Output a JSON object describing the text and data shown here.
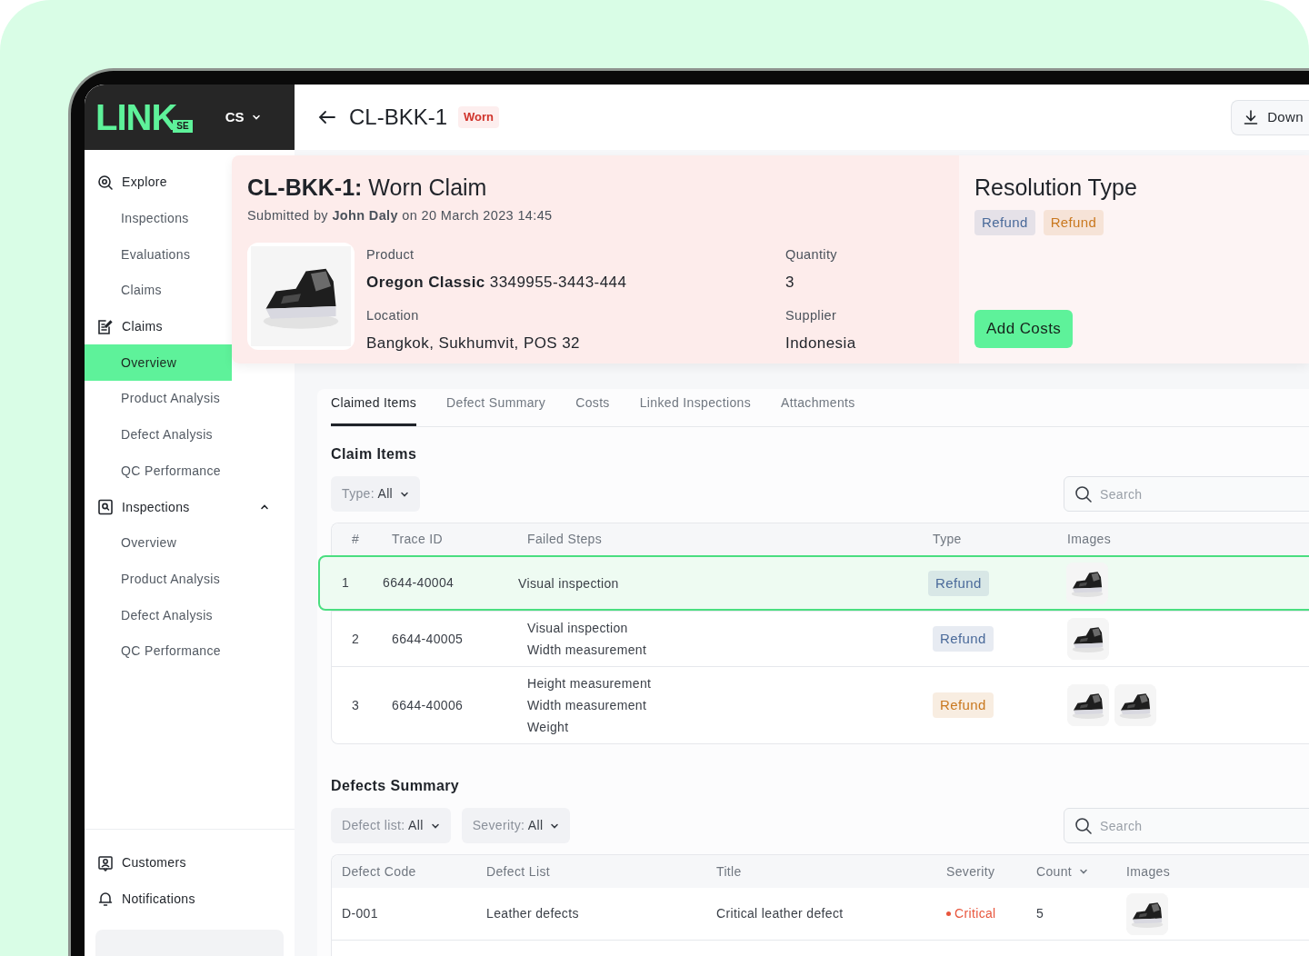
{
  "logo": {
    "text": "LINK",
    "badge": "SE"
  },
  "org_switcher": {
    "label": "CS"
  },
  "sidebar": {
    "sections": [
      {
        "label": "Explore",
        "children": [
          {
            "label": "Inspections",
            "selected": false
          },
          {
            "label": "Evaluations",
            "selected": false
          },
          {
            "label": "Claims",
            "selected": false
          }
        ]
      },
      {
        "label": "Claims",
        "children": [
          {
            "label": "Overview",
            "selected": true
          },
          {
            "label": "Product Analysis",
            "selected": false
          },
          {
            "label": "Defect Analysis",
            "selected": false
          },
          {
            "label": "QC Performance",
            "selected": false
          }
        ]
      },
      {
        "label": "Inspections",
        "expanded": true,
        "children": [
          {
            "label": "Overview",
            "selected": false
          },
          {
            "label": "Product Analysis",
            "selected": false
          },
          {
            "label": "Defect Analysis",
            "selected": false
          },
          {
            "label": "QC Performance",
            "selected": false
          }
        ]
      }
    ],
    "footer": [
      {
        "label": "Customers"
      },
      {
        "label": "Notifications"
      }
    ]
  },
  "header": {
    "title": "CL-BKK-1",
    "badge": "Worn",
    "download_button": "Down"
  },
  "summary": {
    "code": "CL-BKK-1:",
    "title": "Worn Claim",
    "submitted": "Submitted by **John Daly** on 20 March 2023 14:45",
    "fields": [
      {
        "label": "Product",
        "value": "**Oregon Classic** 3349955-3443-444"
      },
      {
        "label": "Quantity",
        "value": "3"
      },
      {
        "label": "Location",
        "value": "Bangkok, Sukhumvit, POS 32"
      },
      {
        "label": "Supplier",
        "value": "Indonesia"
      }
    ]
  },
  "resolution": {
    "title": "Resolution Type",
    "tags": [
      {
        "label": "Refund",
        "color": "#4a6a9a"
      },
      {
        "label": "Refund",
        "color": "#c9781f"
      }
    ],
    "button": "Add Costs"
  },
  "tabs": [
    {
      "label": "Claimed Items",
      "selected": true
    },
    {
      "label": "Defect Summary",
      "selected": false
    },
    {
      "label": "Costs",
      "selected": false
    },
    {
      "label": "Linked Inspections",
      "selected": false
    },
    {
      "label": "Attachments",
      "selected": false
    }
  ],
  "claim_items": {
    "title": "Claim Items",
    "filter": {
      "label": "Type:",
      "value": "All"
    },
    "search": {
      "placeholder": "Search"
    },
    "columns": [
      "#",
      "Trace ID",
      "Failed Steps",
      "Type",
      "Images"
    ],
    "rows": [
      {
        "number": "1",
        "trace_id": "6644-40004",
        "failed_steps": [
          "Visual inspection"
        ],
        "type": {
          "label": "Refund",
          "color": "#4a6a9a"
        },
        "images": [
          {
            "kind": "picture"
          }
        ],
        "selected": true
      },
      {
        "number": "2",
        "trace_id": "6644-40005",
        "failed_steps": [
          "Visual inspection",
          "Width measurement"
        ],
        "type": {
          "label": "Refund",
          "color": "#4a6a9a"
        },
        "images": [
          {
            "kind": "picture"
          }
        ],
        "selected": false
      },
      {
        "number": "3",
        "trace_id": "6644-40006",
        "failed_steps": [
          "Height measurement",
          "Width measurement",
          "Weight"
        ],
        "type": {
          "label": "Refund",
          "color": "#c9781f"
        },
        "images": [
          {
            "kind": "picture"
          },
          {
            "kind": "picture"
          }
        ],
        "selected": false
      }
    ]
  },
  "defects_summary": {
    "title": "Defects Summary",
    "filters": [
      {
        "label": "Defect list:",
        "value": "All"
      },
      {
        "label": "Severity:",
        "value": "All"
      }
    ],
    "search": {
      "placeholder": "Search"
    },
    "columns": [
      {
        "label": "Defect Code",
        "sortable": false
      },
      {
        "label": "Defect List",
        "sortable": false
      },
      {
        "label": "Title",
        "sortable": false
      },
      {
        "label": "Severity",
        "sortable": false
      },
      {
        "label": "Count",
        "sortable": true
      },
      {
        "label": "Images",
        "sortable": false
      }
    ],
    "rows": [
      {
        "code": "D-001",
        "defect_list": "Leather defects",
        "title": "Critical leather defect",
        "severity": {
          "label": "Critical",
          "color": "#e8553c"
        },
        "count": "5",
        "images": [
          {
            "kind": "picture"
          }
        ]
      }
    ]
  }
}
